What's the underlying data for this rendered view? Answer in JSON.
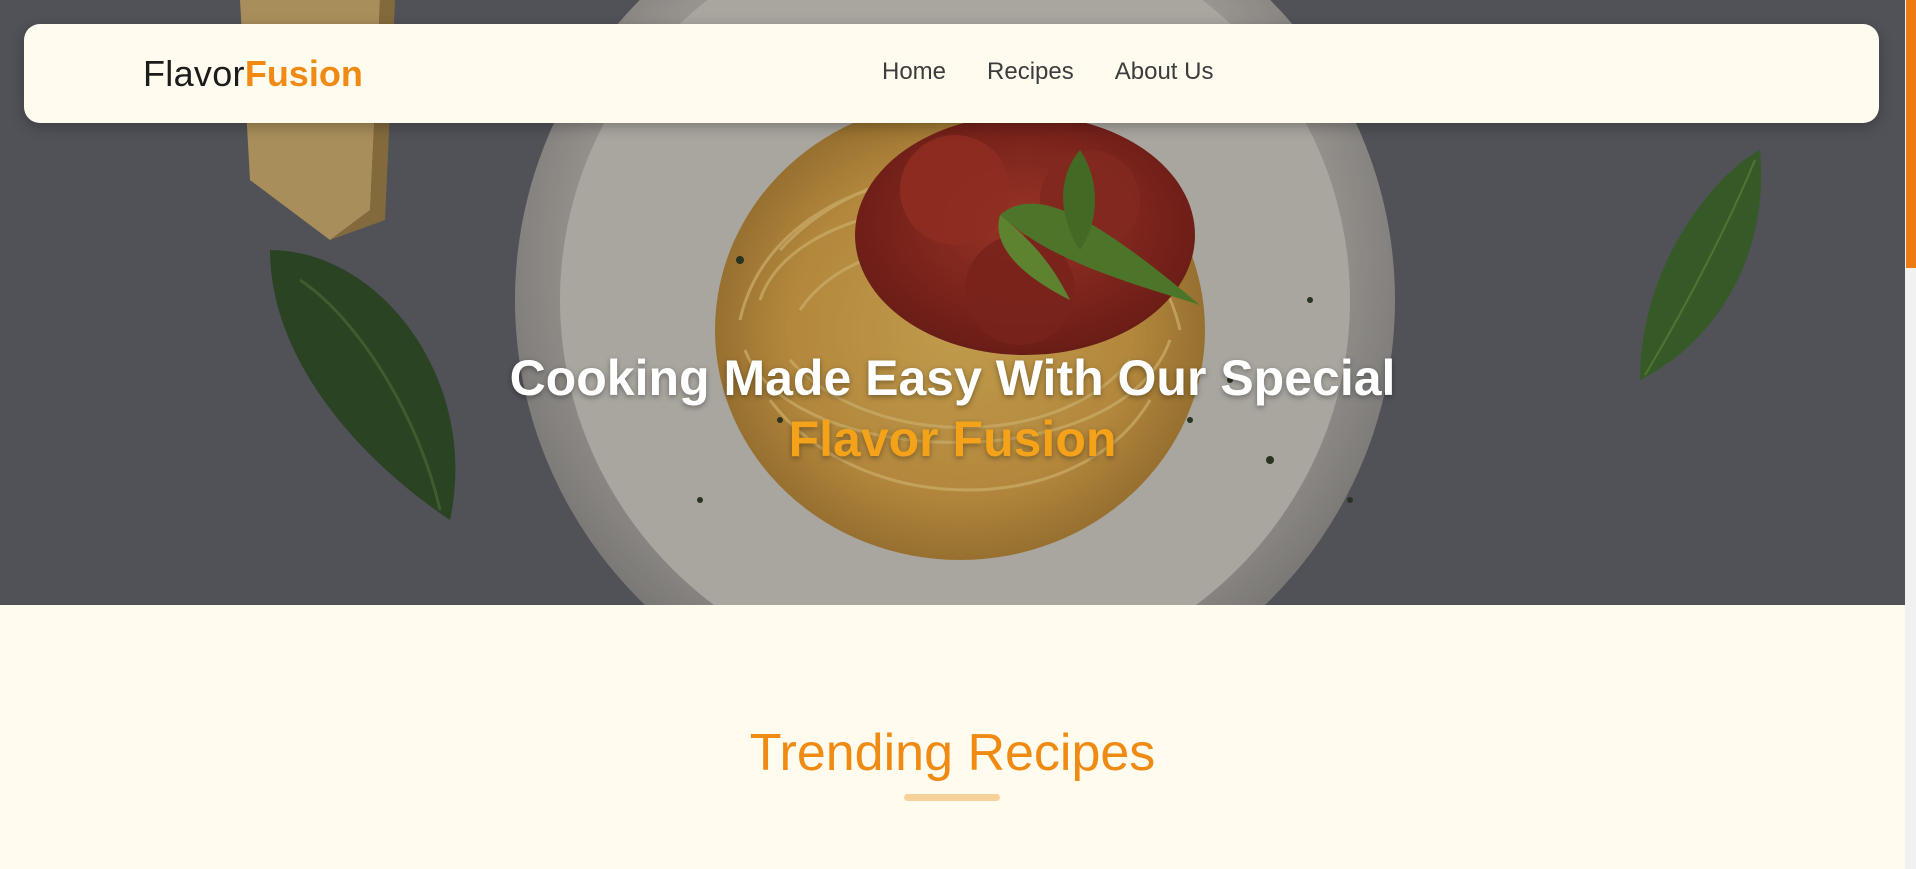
{
  "brand": {
    "part1": "Flavor",
    "part2": "Fusion"
  },
  "nav": {
    "items": [
      {
        "label": "Home"
      },
      {
        "label": "Recipes"
      },
      {
        "label": "About Us"
      }
    ]
  },
  "hero": {
    "title_line1": "Cooking Made Easy With Our Special",
    "title_line2": "Flavor Fusion",
    "background": "spaghetti-with-tomato-sauce-and-basil-photo"
  },
  "section": {
    "title": "Trending Recipes"
  },
  "colors": {
    "accent": "#f08a12",
    "hero_accent": "#f4a21a",
    "background": "#fffcef",
    "scrollbar": "#ee7a14"
  }
}
